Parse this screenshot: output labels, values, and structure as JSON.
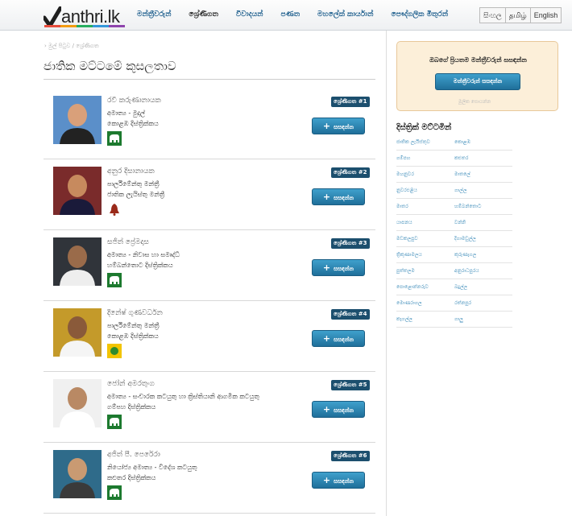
{
  "header": {
    "logo_text": "anthri.lk",
    "nav": [
      "මන්ත්‍රීවරුන්",
      "ශ්‍රේණිගත",
      "විවාදයන්",
      "පණත",
      "මහලේක් කාර්යාන්",
      "පෞද්ගලික මිතුරන්"
    ],
    "languages": [
      "සිංහල",
      "தமிழ்",
      "English"
    ]
  },
  "breadcrumb": "මුල් පිටුව / ශ්‍රේණිගත",
  "page_title": "ජාතික මට්ටමේ කුසලතාව",
  "add_label": "සසඳන්න",
  "members": [
    {
      "name": "රවී කරුණානායක",
      "line1": "අමාත්‍ය - මුදල්",
      "line2": "කොළඹ දිස්ත්‍රික්කය",
      "rank": "ශ්‍රේණිගත #1",
      "party": "elephant"
    },
    {
      "name": "අනුර දිසානායක",
      "line1": "පාර්ලිමේන්තු මන්ත්‍රී",
      "line2": "ජාතික ලැයිස්තු මන්ත්‍රී",
      "rank": "ශ්‍රේණිගත #2",
      "party": "bell"
    },
    {
      "name": "සජිත් ප්‍රේමදාස",
      "line1": "අමාත්‍ය - නිවාස හා සමෘද්ධි",
      "line2": "හම්බන්තොට දිස්ත්‍රික්කය",
      "rank": "ශ්‍රේණිගත #3",
      "party": "elephant"
    },
    {
      "name": "දිනේෂ් ගුණවර්ධන",
      "line1": "පාර්ලිමේන්තු මන්ත්‍රී",
      "line2": "කොළඹ දිස්ත්‍රික්කය",
      "rank": "ශ්‍රේණිගත #4",
      "party": "betel"
    },
    {
      "name": "ජෝන් අමරතුංග",
      "line1": "අමාත්‍ය - සංචාරක කටයුතු හා ක්‍රිස්තියානි ආගමික කටයුතු",
      "line2": "ගම්පහ දිස්ත්‍රික්කය",
      "rank": "ශ්‍රේණිගත #5",
      "party": "elephant"
    },
    {
      "name": "අජිත් පී. පෙරේරා",
      "line1": "නියෝජ්‍ය අමාත්‍ය - විදේශ කටයුතු",
      "line2": "කළුතර දිස්ත්‍රික්කය",
      "rank": "ශ්‍රේණිගත #6",
      "party": "elephant"
    }
  ],
  "sidebar": {
    "promo_title": "ඔබගේ ප්‍රියතම මන්ත්‍රීවරුන් සසඳන්න",
    "promo_button": "මන්ත්‍රීවරුන් සසඳන්න",
    "promo_link": "මූලික සොයන්න",
    "districts_title": "දිස්ත්‍රික් මට්ටමින්",
    "districts": [
      "ජාතික ලැයිස්තුව",
      "කොළඹ",
      "ගම්පහ",
      "කළුතර",
      "මහනුවර",
      "මාතලේ",
      "නුවරඑළිය",
      "ගාල්ල",
      "මාතර",
      "හම්බන්තොට",
      "යාපනය",
      "වන්නි",
      "මඩකලපුව",
      "දිගාමඩුල්ල",
      "ත්‍රිකුණාමලය",
      "කුරුණෑගල",
      "පුත්තලම",
      "අනුරාධපුරය",
      "පොළොන්නරුව",
      "බදුල්ල",
      "මොණරාගල",
      "රත්නපුර",
      "කෑගල්ල",
      "ගාලු"
    ]
  },
  "colors": {
    "accent": "#1f6f9a",
    "rank_badge": "#1c4f6e",
    "promo_bg": "#fcefd9",
    "link": "#3a8ab8"
  }
}
